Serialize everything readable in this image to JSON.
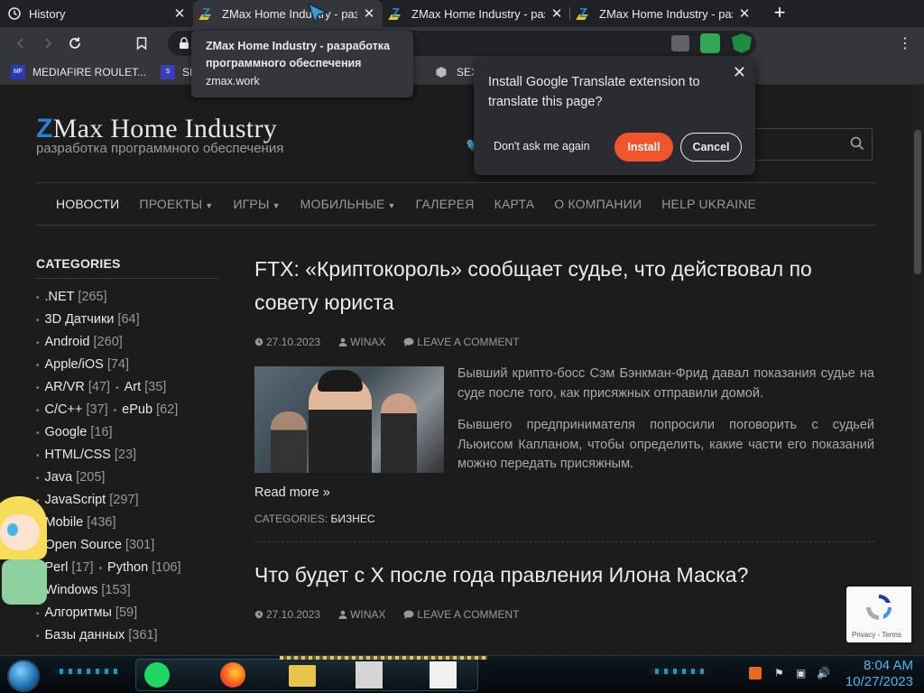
{
  "tabs": [
    {
      "title": "History",
      "icon": "history-icon",
      "active": false
    },
    {
      "title": "ZMax Home Industry - разработка программного обеспечения",
      "icon": "zmax-favicon",
      "active": true
    },
    {
      "title": "ZMax Home Industry - разработка программного обеспечения",
      "icon": "zmax-favicon",
      "active": false
    },
    {
      "title": "ZMax Home Industry - разработка программного обеспечения",
      "icon": "zmax-favicon",
      "active": false
    }
  ],
  "tooltip": {
    "title": "ZMax Home Industry - разработка программного обеспечения",
    "url": "zmax.work"
  },
  "bookmarks": [
    {
      "label": "MEDIAFIRE ROULET...",
      "icon": "MF"
    },
    {
      "label": "SM",
      "icon": "S"
    },
    {
      "label": "SEX I",
      "icon": "box"
    }
  ],
  "translate": {
    "message": "Install Google Translate extension to translate this page?",
    "dont_ask": "Don't ask me again",
    "install": "Install",
    "cancel": "Cancel"
  },
  "site": {
    "title_z": "Z",
    "title_rest": "Max Home Industry",
    "subtitle": "разработка программного обеспечения"
  },
  "nav": [
    {
      "label": "НОВОСТИ",
      "dropdown": false,
      "active": true
    },
    {
      "label": "ПРОЕКТЫ",
      "dropdown": true,
      "active": false
    },
    {
      "label": "ИГРЫ",
      "dropdown": true,
      "active": false
    },
    {
      "label": "МОБИЛЬНЫЕ",
      "dropdown": true,
      "active": false
    },
    {
      "label": "ГАЛЕРЕЯ",
      "dropdown": false,
      "active": false
    },
    {
      "label": "КАРТА",
      "dropdown": false,
      "active": false
    },
    {
      "label": "О КОМПАНИИ",
      "dropdown": false,
      "active": false
    },
    {
      "label": "HELP UKRAINE",
      "dropdown": false,
      "active": false
    }
  ],
  "sidebar": {
    "heading": "CATEGORIES",
    "rows": [
      [
        {
          "name": ".NET",
          "count": "[265]"
        }
      ],
      [
        {
          "name": "3D Датчики",
          "count": "[64]"
        }
      ],
      [
        {
          "name": "Android",
          "count": "[260]"
        }
      ],
      [
        {
          "name": "Apple/iOS",
          "count": "[74]"
        }
      ],
      [
        {
          "name": "AR/VR",
          "count": "[47]"
        },
        {
          "name": "Art",
          "count": "[35]"
        }
      ],
      [
        {
          "name": "C/C++",
          "count": "[37]"
        },
        {
          "name": "ePub",
          "count": "[62]"
        }
      ],
      [
        {
          "name": "Google",
          "count": "[16]"
        }
      ],
      [
        {
          "name": "HTML/CSS",
          "count": "[23]"
        }
      ],
      [
        {
          "name": "Java",
          "count": "[205]"
        }
      ],
      [
        {
          "name": "JavaScript",
          "count": "[297]"
        }
      ],
      [
        {
          "name": "Mobile",
          "count": "[436]"
        }
      ],
      [
        {
          "name": "Open Source",
          "count": "[301]"
        }
      ],
      [
        {
          "name": "Perl",
          "count": "[17]"
        },
        {
          "name": "Python",
          "count": "[106]"
        }
      ],
      [
        {
          "name": "Windows",
          "count": "[153]"
        }
      ],
      [
        {
          "name": "Алгоритмы",
          "count": "[59]"
        }
      ],
      [
        {
          "name": "Базы данных",
          "count": "[361]"
        }
      ]
    ]
  },
  "posts": [
    {
      "title": "FTX: «Криптокороль» сообщает судье, что действовал по совету юриста",
      "date": "27.10.2023",
      "author": "WINAX",
      "comment": "LEAVE A COMMENT",
      "excerpt": [
        "Бывший крипто-босс Сэм Бэнкман-Фрид давал показания судье на суде после того, как присяжных отправили домой.",
        "Бывшего предпринимателя попросили поговорить с судьей Льюисом Капланом, чтобы определить, какие части его показаний можно передать присяжным."
      ],
      "read_more": "Read more »",
      "categories_label": "CATEGORIES:",
      "category": "БИЗНЕС"
    },
    {
      "title": "Что будет с X после года правления Илона Маска?",
      "date": "27.10.2023",
      "author": "WINAX",
      "comment": "LEAVE A COMMENT"
    }
  ],
  "recaptcha": {
    "links": "Privacy - Terms"
  },
  "taskbar": {
    "time": "8:04 AM",
    "date": "10/27/2023"
  }
}
